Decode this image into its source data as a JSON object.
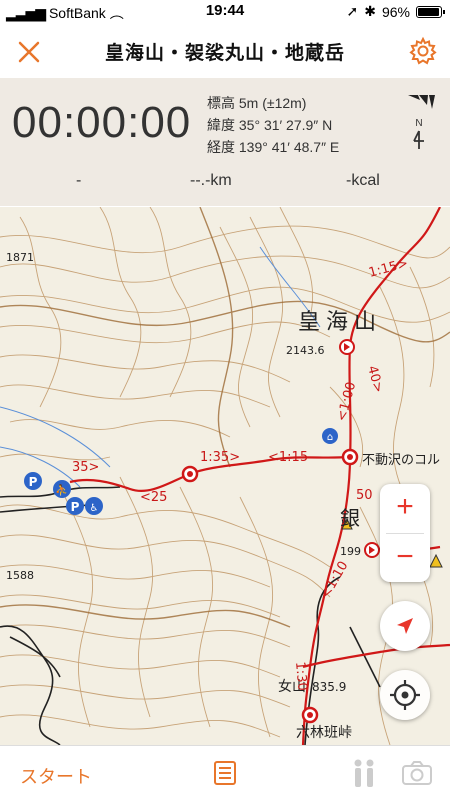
{
  "status": {
    "carrier": "SoftBank",
    "time": "19:44",
    "battery": "96%"
  },
  "nav": {
    "title": "皇海山・袈裟丸山・地蔵岳"
  },
  "stats": {
    "timer": "00:00:00",
    "elevation": "標高 5m (±12m)",
    "latitude": "緯度 35° 31′ 27.9″ N",
    "longitude": "経度 139° 41′ 48.7″ E",
    "dash": "-",
    "distance": "--.-km",
    "kcal": "-kcal",
    "compass_label": "N"
  },
  "map": {
    "labels": {
      "peak_name": "皇海山",
      "peak_elev": "2143.6",
      "pass_name": "不動沢のコル",
      "elev_1871": "1871",
      "elev_1588": "1588",
      "onna": "女山",
      "onna_elev": "835.9",
      "rokurin": "六林班峠",
      "gin": "銀",
      "elev_199": "199"
    },
    "route_labels": [
      "35>",
      "<25",
      "1:35>",
      "<1:15",
      "1:15>",
      "40>",
      "<1:00",
      "50",
      "<1:10",
      "1:30"
    ]
  },
  "bottom": {
    "start_label": "スタート"
  },
  "colors": {
    "accent": "#e8762b",
    "route": "#d01818",
    "contour": "#b07a45"
  }
}
